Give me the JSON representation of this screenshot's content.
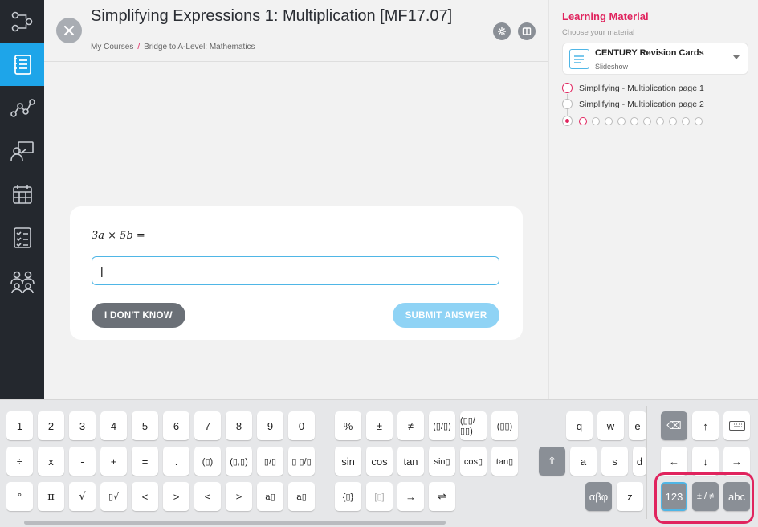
{
  "header": {
    "title": "Simplifying Expressions 1: Multiplication [MF17.07]",
    "breadcrumb": [
      "My Courses",
      "Bridge to A-Level: Mathematics"
    ],
    "breadcrumb_sep": "/"
  },
  "question": {
    "expression": "3a × 5b =",
    "answer_value": "|",
    "idk_label": "I DON'T KNOW",
    "submit_label": "SUBMIT ANSWER"
  },
  "learning_material": {
    "title": "Learning Material",
    "subtitle": "Choose your material",
    "selected": {
      "name": "CENTURY Revision Cards",
      "type": "Slideshow"
    },
    "pages": [
      "Simplifying - Multiplication page 1",
      "Simplifying - Multiplication page 2"
    ],
    "slide_count": 10,
    "active_slide": 1
  },
  "keyboard": {
    "digits": [
      "1",
      "2",
      "3",
      "4",
      "5",
      "6",
      "7",
      "8",
      "9",
      "0"
    ],
    "row2": [
      "÷",
      "x",
      "-",
      "+",
      "=",
      "."
    ],
    "row2b": [
      "(▯)",
      "(▯,▯)",
      "▯/▯",
      "▯ ▯/▯"
    ],
    "row3": [
      "°",
      "π",
      "√",
      "▯√",
      "<",
      ">",
      "≤",
      "≥",
      "a▯",
      "a▯"
    ],
    "sym_row1": [
      "%",
      "±",
      "≠",
      "(▯/▯)",
      "(▯▯/▯▯)",
      "(▯▯)"
    ],
    "sym_row2": [
      "sin",
      "cos",
      "tan",
      "sin▯",
      "cos▯",
      "tan▯"
    ],
    "sym_row3": [
      "{▯}",
      "[▯]",
      "→",
      "⇌"
    ],
    "letters_row1": [
      "q",
      "w",
      "e"
    ],
    "letters_row2": [
      "a",
      "s",
      "d"
    ],
    "letters_row3": [
      "z"
    ],
    "greek_label": "αβφ",
    "mode_labels": [
      "123",
      "± / ≠",
      "abc"
    ],
    "backspace": "⌫",
    "up": "↑",
    "down": "↓",
    "left": "←",
    "right": "→",
    "shift": "⇧"
  },
  "colors": {
    "accent": "#e0245e",
    "primary": "#1ea5e9",
    "sidebar_bg": "#24282e"
  }
}
